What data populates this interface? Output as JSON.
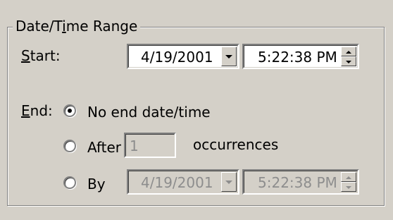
{
  "group": {
    "title": "Date/Time Range",
    "title_prefix": "Date/T",
    "title_mnemonic": "i",
    "title_suffix": "me Range"
  },
  "start": {
    "label_mnemonic": "S",
    "label_rest": "tart:",
    "date_value": "4/19/2001",
    "time_value": "5:22:38 PM"
  },
  "end": {
    "label_mnemonic": "E",
    "label_rest": "nd:",
    "options": [
      {
        "label": "No end date/time",
        "checked": true
      },
      {
        "label": "After",
        "checked": false
      },
      {
        "label": "By",
        "checked": false
      }
    ],
    "after_value": "1",
    "occurrences_label": "occurrences",
    "by_date_value": "4/19/2001",
    "by_time_value": "5:22:38 PM"
  },
  "icons": {
    "dropdown": "chevron-down-icon",
    "spin_up": "spin-up-icon",
    "spin_down": "spin-down-icon"
  },
  "colors": {
    "face": "#d4d0c8",
    "disabled_text": "#8d8d8d"
  }
}
